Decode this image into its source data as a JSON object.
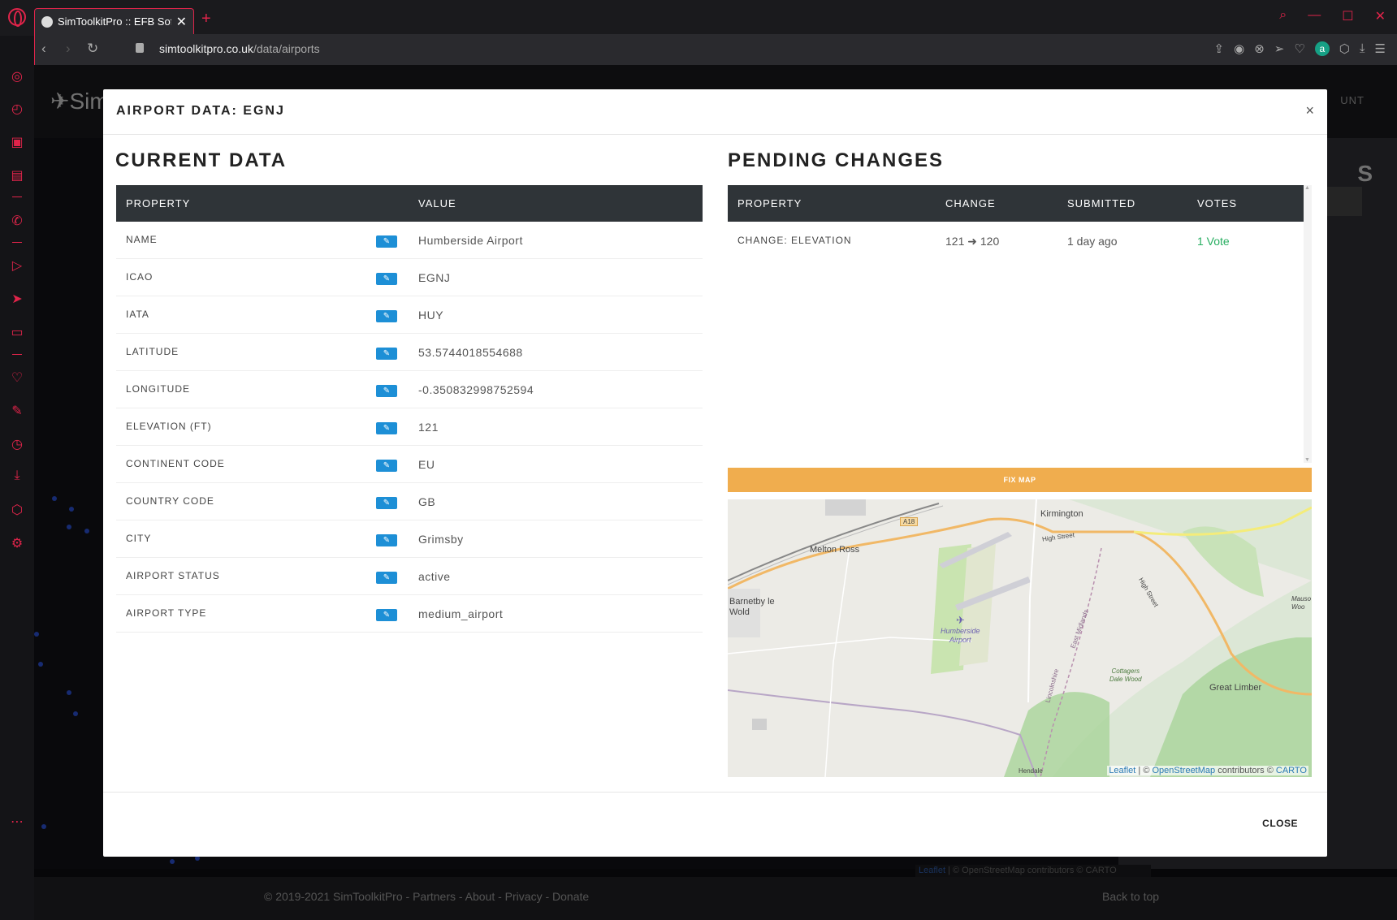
{
  "browser": {
    "tab_title": "SimToolkitPro :: EFB Softwa",
    "tab_close": "✕",
    "new_tab": "+",
    "url_domain": "simtoolkitpro.co.uk",
    "url_path": "/data/airports"
  },
  "background_page": {
    "logo": "Sim",
    "account": "UNT",
    "right_title": "S",
    "map_attribution_leaflet": "Leaflet",
    "map_attribution_rest": " | © OpenStreetMap contributors © CARTO",
    "footer_links": "© 2019-2021 SimToolkitPro - Partners - About - Privacy - Donate",
    "back_to_top": "Back to top"
  },
  "modal": {
    "title": "AIRPORT DATA: EGNJ",
    "close_x": "×",
    "close_button": "CLOSE"
  },
  "current_data": {
    "heading": "CURRENT DATA",
    "col_property": "PROPERTY",
    "col_value": "VALUE",
    "rows": [
      {
        "property": "NAME",
        "value": "Humberside Airport"
      },
      {
        "property": "ICAO",
        "value": "EGNJ"
      },
      {
        "property": "IATA",
        "value": "HUY"
      },
      {
        "property": "LATITUDE",
        "value": "53.5744018554688"
      },
      {
        "property": "LONGITUDE",
        "value": "-0.350832998752594"
      },
      {
        "property": "ELEVATION (FT)",
        "value": "121"
      },
      {
        "property": "CONTINENT CODE",
        "value": "EU"
      },
      {
        "property": "COUNTRY CODE",
        "value": "GB"
      },
      {
        "property": "CITY",
        "value": "Grimsby"
      },
      {
        "property": "AIRPORT STATUS",
        "value": "active"
      },
      {
        "property": "AIRPORT TYPE",
        "value": "medium_airport"
      }
    ]
  },
  "pending_changes": {
    "heading": "PENDING CHANGES",
    "col_property": "PROPERTY",
    "col_change": "CHANGE",
    "col_submitted": "SUBMITTED",
    "col_votes": "VOTES",
    "rows": [
      {
        "property": "CHANGE: ELEVATION",
        "change": "121 ➜ 120",
        "submitted": "1 day ago",
        "votes": "1 Vote"
      }
    ]
  },
  "map": {
    "fix_button": "FIX MAP",
    "labels": {
      "kirmington": "Kirmington",
      "melton_ross": "Melton Ross",
      "barnetby": "Barnetby le\nWold",
      "airport": "Humberside\nAirport",
      "great_limber": "Great Limber",
      "cottagers": "Cottagers\nDale Wood",
      "a18": "A18",
      "high_street": "High Street",
      "high_street_2": "High Street",
      "mauso": "Mauso\nWoo",
      "east_midlands": "East Midlands",
      "lincolnshire": "Lincolnshire",
      "hendale": "Hendale"
    },
    "attrib_leaflet": "Leaflet",
    "attrib_osm": "OpenStreetMap",
    "attrib_contrib": " contributors © ",
    "attrib_carto": "CARTO",
    "attrib_sep": " | © "
  },
  "colors": {
    "accent": "#e0244a",
    "header_bg": "#2f3438",
    "edit_button": "#1d8fd6",
    "fix_map": "#f0ad4e",
    "vote_green": "#27ae60"
  }
}
